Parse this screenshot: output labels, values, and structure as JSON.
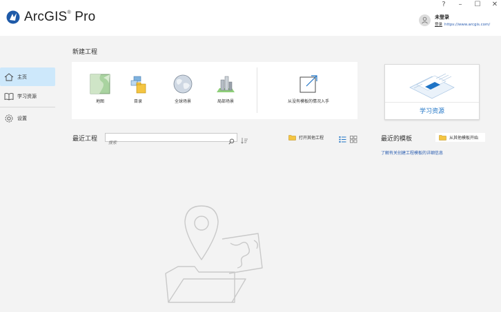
{
  "window": {
    "app_title": "ArcGIS",
    "app_title_mark": "®",
    "app_title_suffix": "Pro",
    "controls": {
      "help": "?",
      "minimize": "–",
      "maximize": "☐",
      "close": "✕"
    }
  },
  "user": {
    "status": "未登录",
    "sign_in": "登录",
    "portal_url": "https://www.arcgis.com/"
  },
  "sidebar": {
    "items": [
      {
        "label": "主页",
        "icon": "home-icon",
        "active": true
      },
      {
        "label": "学习资源",
        "icon": "book-icon",
        "active": false
      },
      {
        "label": "设置",
        "icon": "gear-icon",
        "active": false
      }
    ]
  },
  "new_project": {
    "title": "新建工程",
    "tiles": [
      {
        "label": "地图",
        "icon": "map-icon"
      },
      {
        "label": "目录",
        "icon": "catalog-icon"
      },
      {
        "label": "全球场景",
        "icon": "globe-icon"
      },
      {
        "label": "局部场景",
        "icon": "local-scene-icon"
      },
      {
        "label": "从没有模板的情况入手",
        "icon": "start-without-template-icon"
      }
    ]
  },
  "learning": {
    "label": "学习资源"
  },
  "recent_projects": {
    "title": "最近工程",
    "search_placeholder": "搜索",
    "open_other_label": "打开其他工程"
  },
  "recent_templates": {
    "title": "最近的模板",
    "from_other_label": "从其他模板开始",
    "learn_more_link": "了解有关创建工程模板的详细信息"
  },
  "colors": {
    "accent": "#1f74c6",
    "sidebar_active": "#cde8fb",
    "link": "#2a5db0",
    "logo": "#1e5aa8"
  }
}
